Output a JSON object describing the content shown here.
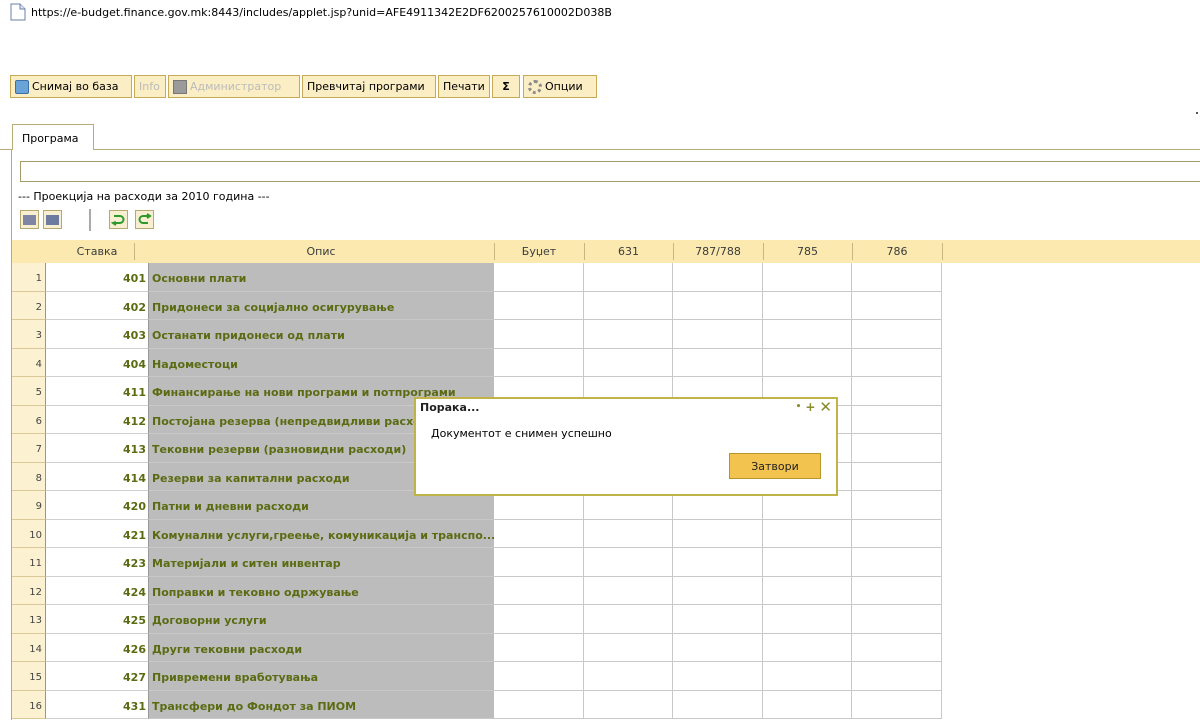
{
  "window": {
    "url": "https://e-budget.finance.gov.mk:8443/includes/applet.jsp?unid=AFE4911342E2DF6200257610002D038B"
  },
  "toolbar": {
    "save_label": "Снимај во база",
    "info_label": "Info",
    "admin_label": "Администратор",
    "recalc_label": "Превчитај програми",
    "print_label": "Печати",
    "sum_label": "Σ",
    "options_label": "Опции"
  },
  "tabs": [
    {
      "label": "Програма"
    }
  ],
  "program": {
    "name_value": "",
    "projection_label": "--- Проекција на расходи за 2010 година ---"
  },
  "grid": {
    "columns": [
      "Ставка",
      "Опис",
      "Буџет",
      "631",
      "787/788",
      "785",
      "786"
    ],
    "rows": [
      {
        "num": "1",
        "code": "401",
        "desc": "Основни плати"
      },
      {
        "num": "2",
        "code": "402",
        "desc": "Придонеси за социјално осигурување"
      },
      {
        "num": "3",
        "code": "403",
        "desc": "Останати придонеси од плати"
      },
      {
        "num": "4",
        "code": "404",
        "desc": "Надоместоци"
      },
      {
        "num": "5",
        "code": "411",
        "desc": "Финансирање на нови програми и потпрограми"
      },
      {
        "num": "6",
        "code": "412",
        "desc": "Постојана резерва (непредвидливи расходи)"
      },
      {
        "num": "7",
        "code": "413",
        "desc": "Тековни резерви (разновидни расходи)"
      },
      {
        "num": "8",
        "code": "414",
        "desc": "Резерви за капитални расходи"
      },
      {
        "num": "9",
        "code": "420",
        "desc": "Патни и дневни расходи"
      },
      {
        "num": "10",
        "code": "421",
        "desc": "Комунални услуги,греење, комуникација и транспо..."
      },
      {
        "num": "11",
        "code": "423",
        "desc": "Материјали и ситен инвентар"
      },
      {
        "num": "12",
        "code": "424",
        "desc": "Поправки и тековно одржување"
      },
      {
        "num": "13",
        "code": "425",
        "desc": "Договорни услуги"
      },
      {
        "num": "14",
        "code": "426",
        "desc": "Други тековни расходи"
      },
      {
        "num": "15",
        "code": "427",
        "desc": "Привремени вработувања"
      },
      {
        "num": "16",
        "code": "431",
        "desc": "Трансфери до Фондот за ПИОМ"
      }
    ]
  },
  "dialog": {
    "title": "Порака...",
    "message": "Документот е снимен успешно",
    "close_label": "Затвори"
  }
}
